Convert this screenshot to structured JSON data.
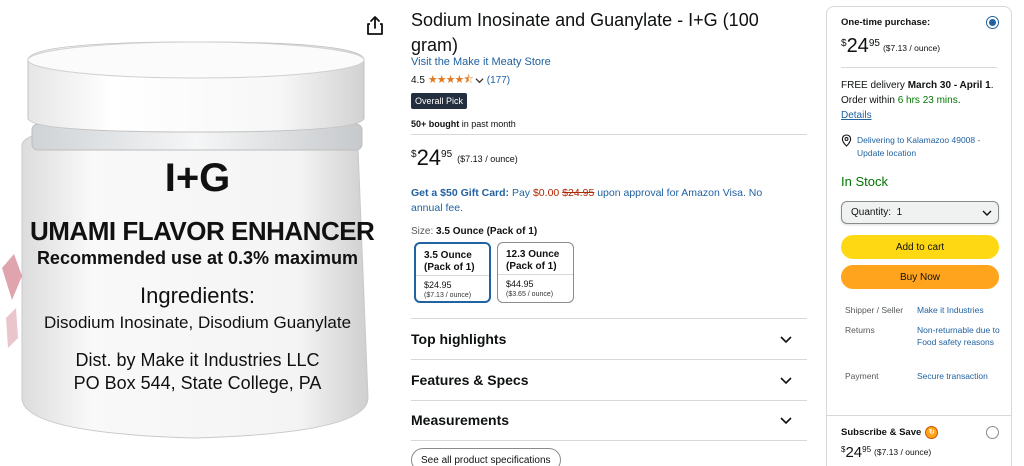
{
  "image_panel": {
    "jar_label": {
      "line1": "I+G",
      "line2": "UMAMI FLAVOR ENHANCER",
      "line3": "Recommended use at 0.3% maximum",
      "line4": "Ingredients:",
      "line5": "Disodium Inosinate, Disodium Guanylate",
      "line6": "Dist. by Make it Industries LLC",
      "line7": "PO Box 544, State College, PA"
    }
  },
  "product": {
    "title": "Sodium Inosinate and Guanylate - I+G (100 gram)",
    "store_link": "Visit the Make it Meaty Store",
    "rating": "4.5",
    "stars": "★★★★⯪",
    "rating_count": "(177)",
    "badge": "Overall Pick",
    "bought_bold": "50+ bought",
    "bought_rest": " in past month",
    "price": {
      "currency": "$",
      "whole": "24",
      "fraction": "95",
      "per_unit": "($7.13 / ounce)"
    },
    "gift_card": {
      "bold": "Get a $50 Gift Card:",
      "pay": " Pay ",
      "new_price": "$0.00",
      "space": " ",
      "old_price": "$24.95",
      "rest": " upon approval for Amazon Visa. No annual fee."
    },
    "size_label": "Size: ",
    "size_selected": "3.5 Ounce (Pack of 1)",
    "sizes": [
      {
        "label": "3.5 Ounce (Pack of 1)",
        "price": "$24.95",
        "per_unit": "($7.13 / ounce)"
      },
      {
        "label": "12.3 Ounce (Pack of 1)",
        "price": "$44.95",
        "per_unit": "($3.65 / ounce)"
      }
    ],
    "sections": [
      "Top highlights",
      "Features & Specs",
      "Measurements"
    ],
    "see_all": "See all product specifications"
  },
  "buybox": {
    "one_time_label": "One-time purchase:",
    "price": {
      "currency": "$",
      "whole": "24",
      "fraction": "95",
      "per_unit": "($7.13 / ounce)"
    },
    "delivery": {
      "prefix": "FREE delivery ",
      "date": "March 30 - April 1",
      "mid": ". Order within ",
      "countdown": "6 hrs 23 mins",
      "end": ".",
      "details": "Details"
    },
    "location": "Delivering to Kalamazoo 49008 - Update location",
    "stock": "In Stock",
    "quantity": "Quantity:  1",
    "add_to_cart": "Add to cart",
    "buy_now": "Buy Now",
    "info": [
      {
        "key": "Shipper / Seller",
        "value": "Make it Industries"
      },
      {
        "key": "Returns",
        "value": "Non-returnable due to Food safety reasons"
      },
      {
        "key": "Payment",
        "value": "Secure transaction"
      }
    ],
    "subscribe_label": "Subscribe & Save",
    "subscribe_price": {
      "currency": "$",
      "whole": "24",
      "fraction": "95",
      "per_unit": "($7.13 / ounce)"
    }
  },
  "colors": {
    "link": "#2162a1",
    "price_red": "#b12704",
    "in_stock_green": "#007600",
    "add_to_cart_yellow": "#ffd814",
    "buy_now_orange": "#ffa41c",
    "badge_dark": "#232f3e"
  },
  "icons": [
    "share-icon",
    "star-icon",
    "chevron-down-icon",
    "location-pin-icon",
    "radio-icon",
    "subscribe-badge-icon"
  ]
}
